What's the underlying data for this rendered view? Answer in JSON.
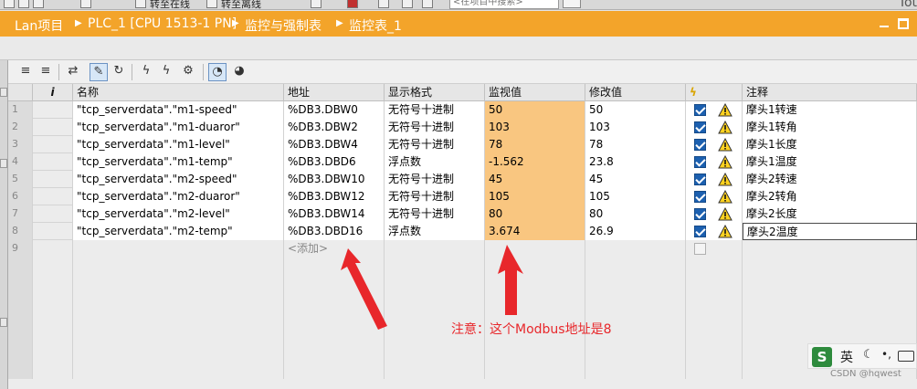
{
  "toolbar_top": {
    "go_online_label": "转至在线",
    "go_offline_label": "转至离线",
    "search_placeholder": "<在项目中搜索>",
    "right_text": "Tot"
  },
  "breadcrumb": [
    "Lan项目",
    "PLC_1 [CPU 1513-1 PN]",
    "监控与强制表",
    "监控表_1"
  ],
  "table": {
    "headers": {
      "index": "i",
      "name": "名称",
      "address": "地址",
      "format": "显示格式",
      "monitor": "监视值",
      "modify": "修改值",
      "flag": "",
      "comment": "注释"
    },
    "rows": [
      {
        "n": "1",
        "name": "\"tcp_serverdata\".\"m1-speed\"",
        "address": "%DB3.DBW0",
        "format": "无符号十进制",
        "monitor": "50",
        "modify": "50",
        "comment": "摩头1转速"
      },
      {
        "n": "2",
        "name": "\"tcp_serverdata\".\"m1-duaror\"",
        "address": "%DB3.DBW2",
        "format": "无符号十进制",
        "monitor": "103",
        "modify": "103",
        "comment": "摩头1转角"
      },
      {
        "n": "3",
        "name": "\"tcp_serverdata\".\"m1-level\"",
        "address": "%DB3.DBW4",
        "format": "无符号十进制",
        "monitor": "78",
        "modify": "78",
        "comment": "摩头1长度"
      },
      {
        "n": "4",
        "name": "\"tcp_serverdata\".\"m1-temp\"",
        "address": "%DB3.DBD6",
        "format": "浮点数",
        "monitor": "-1.562",
        "modify": "23.8",
        "comment": "摩头1温度"
      },
      {
        "n": "5",
        "name": "\"tcp_serverdata\".\"m2-speed\"",
        "address": "%DB3.DBW10",
        "format": "无符号十进制",
        "monitor": "45",
        "modify": "45",
        "comment": "摩头2转速"
      },
      {
        "n": "6",
        "name": "\"tcp_serverdata\".\"m2-duaror\"",
        "address": "%DB3.DBW12",
        "format": "无符号十进制",
        "monitor": "105",
        "modify": "105",
        "comment": "摩头2转角"
      },
      {
        "n": "7",
        "name": "\"tcp_serverdata\".\"m2-level\"",
        "address": "%DB3.DBW14",
        "format": "无符号十进制",
        "monitor": "80",
        "modify": "80",
        "comment": "摩头2长度"
      },
      {
        "n": "8",
        "name": "\"tcp_serverdata\".\"m2-temp\"",
        "address": "%DB3.DBD16",
        "format": "浮点数",
        "monitor": "3.674",
        "modify": "26.9",
        "comment": "摩头2温度"
      }
    ],
    "add_row": {
      "n": "9",
      "add_label": "<添加>"
    },
    "empty_rows": 7
  },
  "annotation": "注意：这个Modbus地址是8",
  "annotation_color": "#e8272b",
  "ime": {
    "logo": "S",
    "lang": "英"
  },
  "watermark": "CSDN @hqwest",
  "colors": {
    "accent": "#f3a42a",
    "monitor_cell": "#f9c680",
    "checkbox": "#1c60b0"
  }
}
